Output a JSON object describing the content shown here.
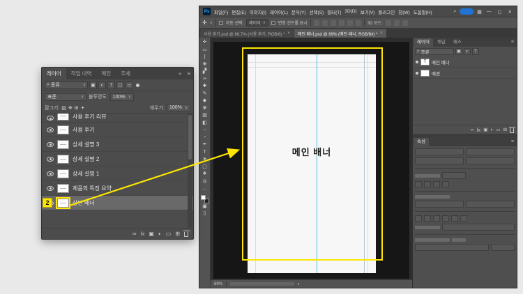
{
  "page": {
    "background": "#e9e9e9",
    "accent_yellow": "#ffe600"
  },
  "ui": {
    "caret": "∨",
    "menu_icon": "≡",
    "collapse_icon": "»",
    "search_glyph": "⌕",
    "more_glyph": "…"
  },
  "callout": {
    "badge": "2"
  },
  "layers_panel": {
    "tabs": [
      "레이어",
      "작업 내역",
      "메인",
      "추세"
    ],
    "filter": {
      "search_label": "종류",
      "icons": [
        "▣",
        "◐",
        "T",
        "▢",
        "▭"
      ]
    },
    "blend": {
      "mode": "표준",
      "opacity_label": "불투명도:",
      "opacity": "100%"
    },
    "lock": {
      "label": "잠그기:",
      "icons": [
        "▨",
        "✥",
        "⊞",
        "✦"
      ],
      "fill_label": "채우기:",
      "fill": "100%"
    },
    "layers": [
      "사용 후기 리뷰",
      "사용 후기",
      "상세 설명 3",
      "상세 설명 2",
      "상세 설명 1",
      "제품의 특징 요약",
      "상단 배너"
    ],
    "footer": {
      "link": "∞",
      "fx": "fx",
      "mask": "▣",
      "adjust": "◐",
      "group": "▭",
      "new": "⊞"
    }
  },
  "window": {
    "logo": "Ps",
    "menu": [
      "파일(F)",
      "편집(E)",
      "이미지(I)",
      "레이어(L)",
      "문자(Y)",
      "선택(S)",
      "필터(T)",
      "3D(D)",
      "보기(V)",
      "플러그인",
      "창(W)",
      "도움말(H)"
    ],
    "controls": {
      "minimize": "—",
      "maximize": "▢",
      "close": "✕"
    },
    "options": {
      "auto_select_label": "자동 선택:",
      "auto_select_value": "레이어",
      "transform_label": "변형 컨트롤 표시",
      "mode_label": "3D 모드:"
    },
    "doc_tabs": [
      "사용 후기.psd @ 66.7% (사용 후기, RGB/8) *",
      "메인 배너.psd @ 69% (메인 배너, RGB/8#) *"
    ],
    "tab_close": "×",
    "status_zoom": "69%"
  },
  "canvas": {
    "label": "메인 배너"
  },
  "toolbar": {
    "fg_color": "#ffffff",
    "bg_color": "#202020",
    "quick_mask_glyph": "▣",
    "screen_mode_glyph": "▯",
    "tools": [
      {
        "name": "move",
        "glyph": "✛"
      },
      {
        "name": "marquee",
        "glyph": "▭"
      },
      {
        "name": "lasso",
        "glyph": "∫"
      },
      {
        "name": "quick-selection",
        "glyph": "❋"
      },
      {
        "name": "crop",
        "glyph": "▞"
      },
      {
        "name": "eyedropper",
        "glyph": "✑"
      },
      {
        "name": "spot-healing",
        "glyph": "✚"
      },
      {
        "name": "brush",
        "glyph": "✎"
      },
      {
        "name": "clone-stamp",
        "glyph": "◆"
      },
      {
        "name": "history-brush",
        "glyph": "✾"
      },
      {
        "name": "eraser",
        "glyph": "▨"
      },
      {
        "name": "gradient",
        "glyph": "◧"
      },
      {
        "name": "blur",
        "glyph": "◦"
      },
      {
        "name": "dodge",
        "glyph": "◔"
      },
      {
        "name": "pen",
        "glyph": "✒"
      },
      {
        "name": "type",
        "glyph": "T"
      },
      {
        "name": "path-select",
        "glyph": "➤"
      },
      {
        "name": "shape",
        "glyph": "▢"
      },
      {
        "name": "hand",
        "glyph": "❖"
      },
      {
        "name": "zoom",
        "glyph": "◎"
      }
    ]
  },
  "right_panels": {
    "layers": {
      "tabs": [
        "레이어",
        "채널",
        "패스"
      ],
      "search_label": "종류",
      "rows": [
        {
          "name": "메인 배너",
          "thumb": "T"
        },
        {
          "name": "배경",
          "thumb": ""
        }
      ]
    },
    "properties": {
      "tab": "속성"
    }
  }
}
